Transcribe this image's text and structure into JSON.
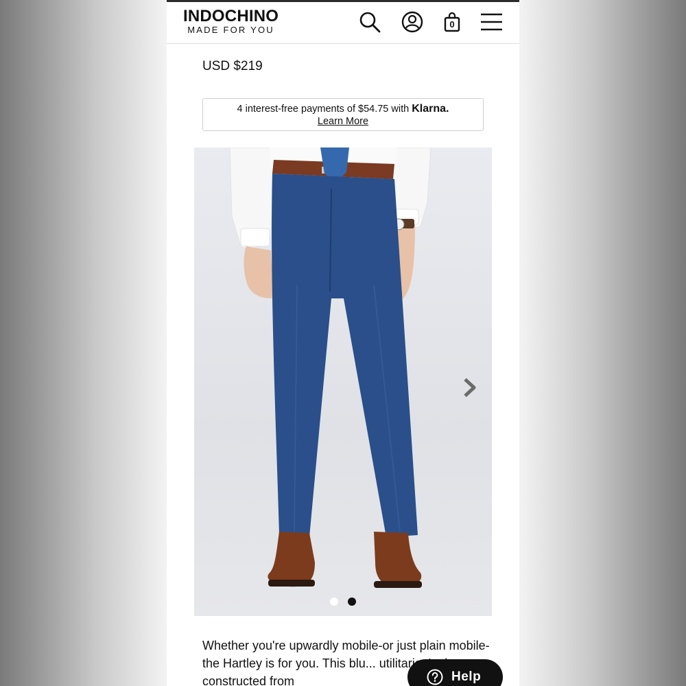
{
  "header": {
    "brand_name": "INDOCHINO",
    "brand_tagline": "MADE FOR YOU",
    "cart_count": "0",
    "icons": [
      "search-icon",
      "account-icon",
      "shopping-bag-icon",
      "menu-icon"
    ]
  },
  "product": {
    "price": "USD $219",
    "klarna": {
      "text": "4 interest-free payments of $54.75 with",
      "brand": "Klarna.",
      "link": "Learn More"
    },
    "gallery": {
      "image_alt": "Model wearing blue slim-fit dress pants with white shirt, blue tie, brown belt and brown leather shoes",
      "slides": 2,
      "active_slide": 2
    },
    "description": "Whether you're upwardly mobile-or just plain mobile-the Hartley is for you. This blu... utilitarian's dream, constructed from"
  },
  "help": {
    "label": "Help"
  },
  "colors": {
    "accent": "#111111",
    "page_bg": "#ffffff",
    "trouser_blue": "#2a4f8a"
  }
}
